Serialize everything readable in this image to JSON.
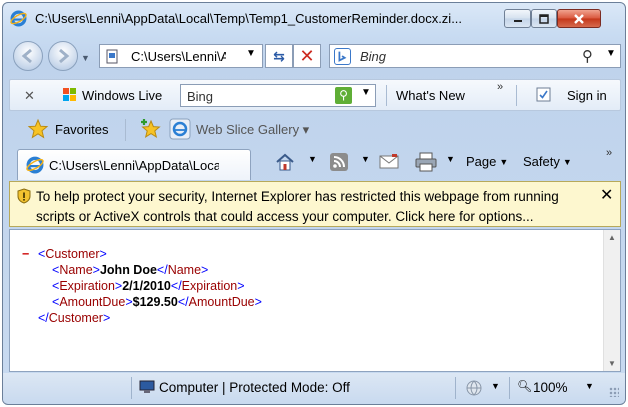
{
  "window": {
    "title": "C:\\Users\\Lenni\\AppData\\Local\\Temp\\Temp1_CustomerReminder.docx.zi..."
  },
  "address_bar": {
    "url": "C:\\Users\\Lenni\\A",
    "search_placeholder": "Bing"
  },
  "links_bar": {
    "close_glyph": "✕",
    "windows_live_label": "Windows Live",
    "search_placeholder": "Bing",
    "whats_new_label": "What's New",
    "overflow_glyph": "»",
    "sign_in_label": "Sign in"
  },
  "favorites_bar": {
    "favorites_label": "Favorites",
    "web_slice_label": "Web Slice Gallery ▾"
  },
  "tabs": [
    {
      "label": "C:\\Users\\Lenni\\AppData\\Local..."
    }
  ],
  "command_bar": {
    "page_label": "Page",
    "safety_label": "Safety",
    "overflow_glyph": "»"
  },
  "info_bar": {
    "message": "To help protect your security, Internet Explorer has restricted this webpage from running scripts or ActiveX controls that could access your computer. Click here for options...",
    "close_glyph": "✕"
  },
  "document": {
    "collapse_glyph": "−",
    "root_tag": "Customer",
    "fields": [
      {
        "tag": "Name",
        "value": "John Doe"
      },
      {
        "tag": "Expiration",
        "value": "2/1/2010"
      },
      {
        "tag": "AmountDue",
        "value": "$129.50"
      }
    ]
  },
  "status_bar": {
    "zone_text": "Computer | Protected Mode: Off",
    "zoom_text": "100%"
  },
  "colors": {
    "xml_tag": "#990000",
    "xml_bracket": "#0000ff",
    "collapse": "#cc0000",
    "info_bar_bg": "#fdf7cf",
    "close_button": "#c4361a"
  },
  "icons": [
    "ie-icon",
    "back-icon",
    "forward-icon",
    "page-icon",
    "refresh-icon",
    "stop-icon",
    "bing-icon",
    "search-icon",
    "windows-flag-icon",
    "go-icon",
    "sign-in-icon",
    "favorites-star-icon",
    "add-favorites-icon",
    "web-slice-icon",
    "home-icon",
    "rss-icon",
    "mail-icon",
    "print-icon",
    "shield-icon",
    "computer-icon",
    "globe-icon",
    "zoom-icon"
  ]
}
